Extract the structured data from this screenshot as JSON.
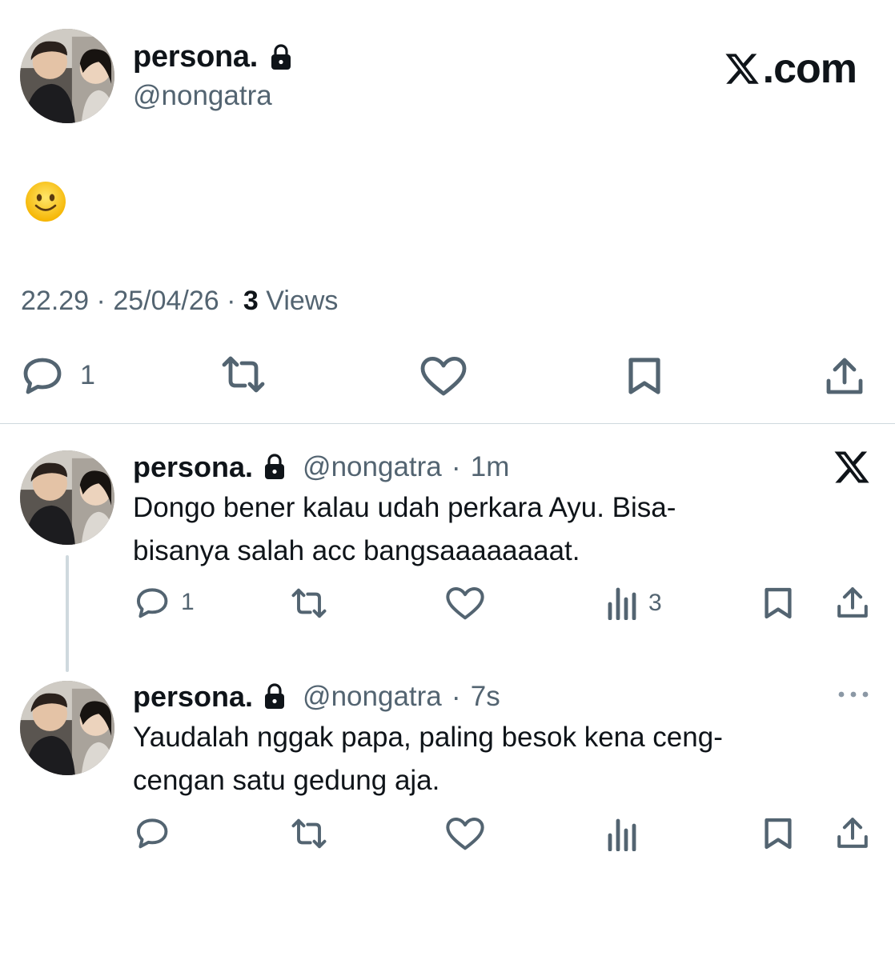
{
  "main_post": {
    "display_name": "persona.",
    "handle": "@nongatra",
    "brand": ".com",
    "text_emoji": "🙂",
    "time": "22.29",
    "date": "25/04/26",
    "views_count": "3",
    "views_label": "Views",
    "separator": "·",
    "reply_count": "1"
  },
  "replies": [
    {
      "display_name": "persona.",
      "handle": "@nongatra",
      "time_ago": "1m",
      "separator": "·",
      "text_line1": "Dongo bener kalau udah perkara Ayu. Bisa-",
      "text_line2": "bisanya salah acc bangsaaaaaaaat.",
      "reply_count": "1",
      "views_count": "3"
    },
    {
      "display_name": "persona.",
      "handle": "@nongatra",
      "time_ago": "7s",
      "separator": "·",
      "text_line1": "Yaudalah nggak papa, paling besok kena ceng-",
      "text_line2": "cengan satu gedung aja."
    }
  ],
  "colors": {
    "text": "#0f1419",
    "secondary": "#536471",
    "divider": "#cfd9de"
  }
}
